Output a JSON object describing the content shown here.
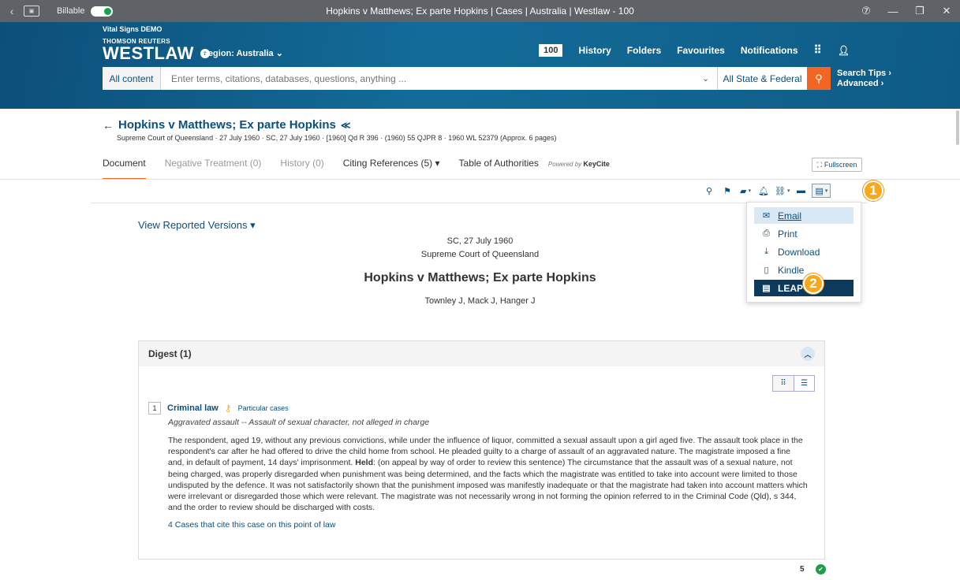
{
  "window": {
    "title": "Hopkins v Matthews; Ex parte Hopkins | Cases | Australia | Westlaw - 100",
    "billable_label": "Billable",
    "help_glyph": "⑦",
    "minimize_glyph": "—",
    "maximize_glyph": "❐",
    "close_glyph": "✕"
  },
  "brand": {
    "org": "Vital Signs DEMO",
    "company": "THOMSON REUTERS",
    "product": "WESTLAW"
  },
  "region": {
    "label": "Region: Australia"
  },
  "nav": {
    "count": "100",
    "history": "History",
    "folders": "Folders",
    "favourites": "Favourites",
    "notifications": "Notifications"
  },
  "search": {
    "scope": "All content",
    "placeholder": "Enter terms, citations, databases, questions, anything ...",
    "jurisdiction": "All State & Federal",
    "tips": "Search Tips",
    "advanced": "Advanced"
  },
  "document": {
    "title": "Hopkins v Matthews; Ex parte Hopkins",
    "meta": "Supreme Court of Queensland  ·  27 July 1960  ·  SC, 27 July 1960  ·  [1960] Qd R 396  ·  (1960) 55 QJPR 8  ·  1960 WL 52379  (Approx. 6 pages)"
  },
  "tabs": {
    "document": "Document",
    "negative": "Negative Treatment (0)",
    "history": "History (0)",
    "citing": "Citing References (5)",
    "toa": "Table of Authorities",
    "powered_by": "Powered by",
    "keycite": "KeyCite"
  },
  "fullscreen_label": "Fullscreen",
  "badges": {
    "one": "1",
    "two": "2"
  },
  "delivery_menu": {
    "email": "Email",
    "print": "Print",
    "download": "Download",
    "kindle": "Kindle",
    "leap": "LEAP"
  },
  "view_versions": "View Reported Versions",
  "court_date": "SC, 27 July 1960",
  "court_name": "Supreme Court of Queensland",
  "case_name": "Hopkins v Matthews; Ex parte Hopkins",
  "judges": "Townley J, Mack J, Hanger J",
  "digest": {
    "heading": "Digest (1)",
    "entry": {
      "number": "1",
      "topic": "Criminal law",
      "subtopic": "Particular cases",
      "italic": "Aggravated assault -- Assault of sexual character, not alleged in charge",
      "body_pre": "The respondent, aged 19, without any previous convictions, while under the influence of liquor, committed a sexual assault upon a girl aged five. The assault took place in the respondent's car after he had offered to drive the child home from school. He pleaded guilty to a charge of assault of an aggravated nature. The magistrate imposed a fine and, in default of payment, 14 days' imprisonment. ",
      "held_label": "Held",
      "body_post": ": (on appeal by way of order to review this sentence) The circumstance that the assault was of a sexual nature, not being charged, was properly disregarded when punishment was being determined, and the facts which the magistrate was entitled to take into account were limited to those undisputed by the defence. It was not satisfactorily shown that the punishment imposed was manifestly inadequate or that the magistrate had taken into account matters which were irrelevant or disregarded those which were relevant. The magistrate was not necessarily wrong in not forming the opinion referred to in the Criminal Code (Qld), s 344, and the order to review should be discharged with costs.",
      "link": "4 Cases that cite this case on this point of law"
    }
  },
  "footer": {
    "count": "5"
  },
  "colors": {
    "brand_blue": "#0f5f88",
    "link_blue": "#0b4f7d",
    "accent_orange": "#f26522",
    "badge_gold": "#f7a81b"
  }
}
